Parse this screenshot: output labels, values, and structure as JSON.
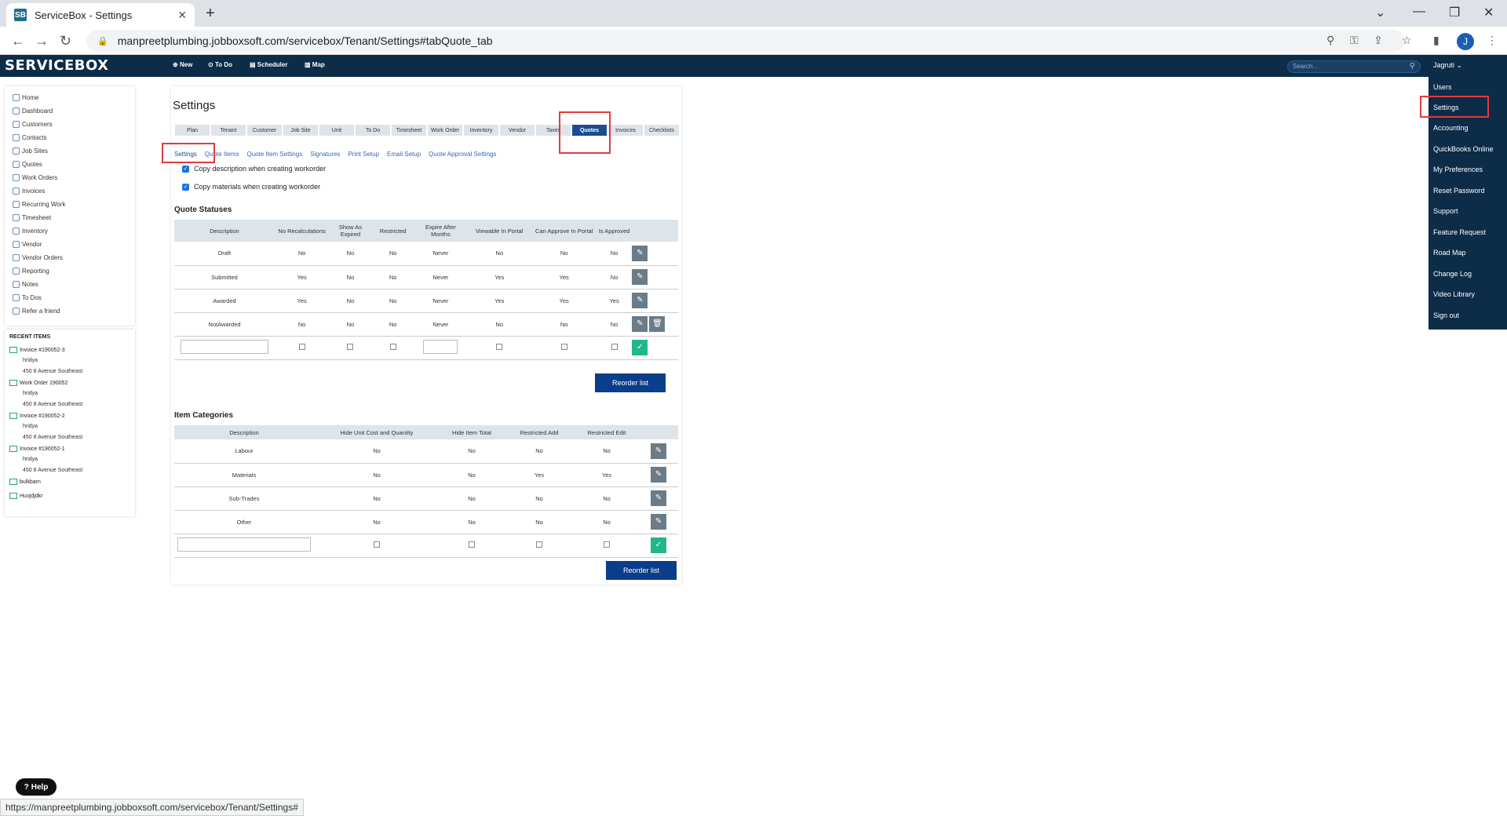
{
  "browser": {
    "tab_title": "ServiceBox - Settings",
    "favicon": "SB",
    "url": "manpreetplumbing.jobboxsoft.com/servicebox/Tenant/Settings#tabQuote_tab",
    "avatar": "J"
  },
  "app": {
    "logo": "SERVICEBOX",
    "nav": [
      "New",
      "To Do",
      "Scheduler",
      "Map"
    ],
    "search_placeholder": "Search...",
    "user": "Jagruti"
  },
  "user_menu": [
    "Users",
    "Settings",
    "Accounting",
    "QuickBooks Online",
    "My Preferences",
    "Reset Password",
    "Support",
    "Feature Request",
    "Road Map",
    "Change Log",
    "Video Library",
    "Sign out"
  ],
  "sidebar": [
    "Home",
    "Dashboard",
    "Customers",
    "Contacts",
    "Job Sites",
    "Quotes",
    "Work Orders",
    "Invoices",
    "Recurring Work",
    "Timesheet",
    "Inventory",
    "Vendor",
    "Vendor Orders",
    "Reporting",
    "Notes",
    "To Dos",
    "Refer a friend"
  ],
  "recent": {
    "title": "RECENT ITEMS",
    "items": [
      {
        "name": "Invoice #190052-3",
        "l1": "hridya",
        "l2": "450 8 Avenue Southeast"
      },
      {
        "name": "Work Order 190052",
        "l1": "hridya",
        "l2": "450 8 Avenue Southeast"
      },
      {
        "name": "Invoice #190052-2",
        "l1": "hridya",
        "l2": "450 8 Avenue Southeast"
      },
      {
        "name": "Invoice #190052-1",
        "l1": "hridya",
        "l2": "450 8 Avenue Southeast"
      },
      {
        "name": "bulkbarn",
        "l1": "",
        "l2": ""
      },
      {
        "name": "Huojdjdkr",
        "l1": "",
        "l2": ""
      }
    ]
  },
  "settings": {
    "title": "Settings",
    "tabs": [
      "Plan",
      "Tenant",
      "Customer",
      "Job Site",
      "Unit",
      "To Do",
      "Timesheet",
      "Work Order",
      "Inventory",
      "Vendor",
      "Taxes",
      "Quotes",
      "Invoices",
      "Checklists"
    ],
    "subtabs": [
      "Settings",
      "Quote Items",
      "Quote Item Settings",
      "Signatures",
      "Print Setup",
      "Email Setup",
      "Quote Approval Settings"
    ],
    "checkbox1": "Copy description when creating workorder",
    "checkbox2": "Copy materials when creating workorder",
    "quote_statuses_title": "Quote Statuses",
    "qs_headers": [
      "Description",
      "No Recalculations",
      "Show As Expired",
      "Restricted",
      "Expire After Months",
      "Viewable In Portal",
      "Can Approve In Portal",
      "Is Approved"
    ],
    "qs_rows": [
      [
        "Draft",
        "No",
        "No",
        "No",
        "Never",
        "No",
        "No",
        "No"
      ],
      [
        "Submitted",
        "Yes",
        "No",
        "No",
        "Never",
        "Yes",
        "Yes",
        "No"
      ],
      [
        "Awarded",
        "Yes",
        "No",
        "No",
        "Never",
        "Yes",
        "Yes",
        "Yes"
      ],
      [
        "NotAwarded",
        "No",
        "No",
        "No",
        "Never",
        "No",
        "No",
        "No"
      ]
    ],
    "reorder": "Reorder list",
    "item_categories_title": "Item Categories",
    "ic_headers": [
      "Description",
      "Hide Unit Cost and Quantity",
      "Hide Item Total",
      "Restricted Add",
      "Restricted Edit"
    ],
    "ic_rows": [
      [
        "Labour",
        "No",
        "No",
        "No",
        "No"
      ],
      [
        "Materials",
        "No",
        "No",
        "Yes",
        "Yes"
      ],
      [
        "Sub-Trades",
        "No",
        "No",
        "No",
        "No"
      ],
      [
        "Other",
        "No",
        "No",
        "No",
        "No"
      ]
    ]
  },
  "help": "Help",
  "status_url": "https://manpreetplumbing.jobboxsoft.com/servicebox/Tenant/Settings#"
}
